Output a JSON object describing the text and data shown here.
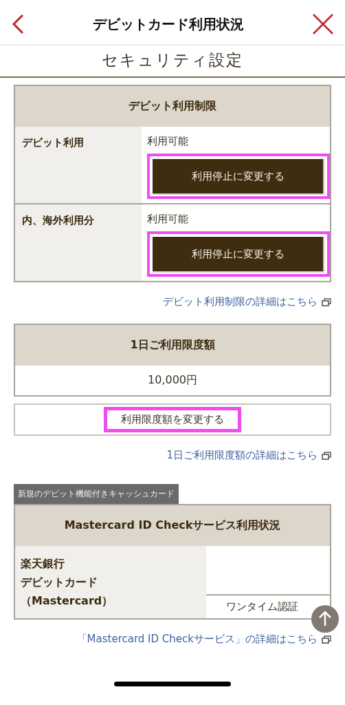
{
  "header": {
    "title": "デビットカード利用状況"
  },
  "section_title": "セキュリティ設定",
  "debit_limits": {
    "heading": "デビット利用制限",
    "rows": [
      {
        "label": "デビット利用",
        "status": "利用可能",
        "button": {
          "label": "利用停止に変更する",
          "highlighted": true
        }
      },
      {
        "label": "内、海外利用分",
        "status": "利用可能",
        "button": {
          "label": "利用停止に変更する",
          "highlighted": true
        }
      }
    ]
  },
  "debit_limits_link": "デビット利用制限の詳細はこちら",
  "daily_limit": {
    "heading": "1日ご利用限度額",
    "value": "10,000円",
    "button": {
      "label": "利用限度額を変更する",
      "highlighted": true
    }
  },
  "daily_limit_link": "1日ご利用限度額の詳細はこちら",
  "card_tag": "新規のデビット機能付きキャッシュカード",
  "id_check": {
    "heading": "Mastercard ID Checkサービス利用状況",
    "card_name_lines": [
      "楽天銀行",
      "デビットカード",
      "（Mastercard）"
    ],
    "status": "ワンタイム認証"
  },
  "id_check_link": "「Mastercard ID Checkサービス」の詳細はこちら"
}
